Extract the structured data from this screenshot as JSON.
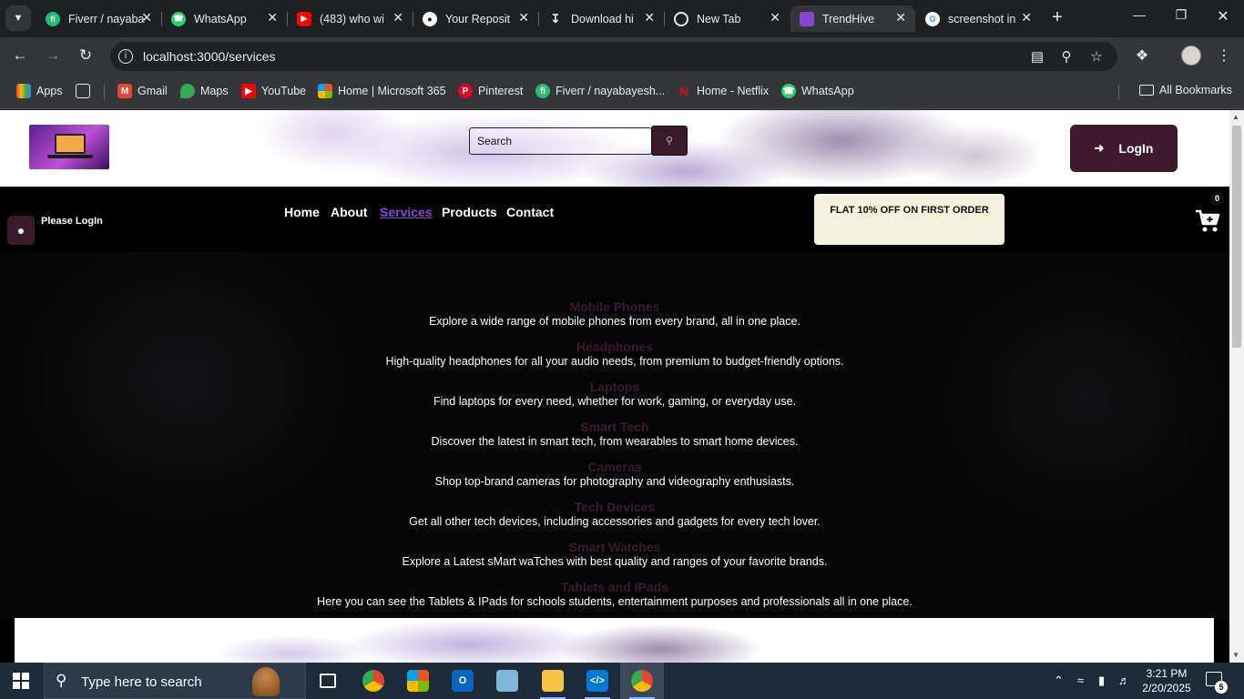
{
  "browser": {
    "tabs": [
      {
        "title": "Fiverr / nayaba",
        "icon": "fiverr-icon",
        "color": "#1dbf73"
      },
      {
        "title": "WhatsApp",
        "icon": "whatsapp-icon",
        "color": "#25d366"
      },
      {
        "title": "(483) who wi",
        "icon": "youtube-icon",
        "color": "#ff0000"
      },
      {
        "title": "Your Reposit",
        "icon": "github-icon",
        "color": "#ffffff"
      },
      {
        "title": "Download hi",
        "icon": "download-icon",
        "color": "#e8eaed"
      },
      {
        "title": "New Tab",
        "icon": "chrome-icon",
        "color": "#e8eaed"
      },
      {
        "title": "TrendHive",
        "icon": "trendhive-icon",
        "color": "#8b45d4",
        "active": true
      },
      {
        "title": "screenshot in",
        "icon": "google-icon",
        "color": "#4285f4"
      }
    ],
    "url": "localhost:3000/services",
    "bookmarks": [
      {
        "label": "Apps",
        "icon": "apps-grid-icon"
      },
      {
        "label": "",
        "icon": "tab-groups-icon"
      },
      {
        "label": "Gmail",
        "icon": "gmail-icon"
      },
      {
        "label": "Maps",
        "icon": "maps-icon"
      },
      {
        "label": "YouTube",
        "icon": "youtube-icon"
      },
      {
        "label": "Home | Microsoft 365",
        "icon": "microsoft-icon"
      },
      {
        "label": "Pinterest",
        "icon": "pinterest-icon"
      },
      {
        "label": "Fiverr / nayabayesh...",
        "icon": "fiverr-icon"
      },
      {
        "label": "Home - Netflix",
        "icon": "netflix-icon"
      },
      {
        "label": "WhatsApp",
        "icon": "whatsapp-icon"
      }
    ],
    "all_bookmarks": "All Bookmarks"
  },
  "site": {
    "search_placeholder": "Search",
    "login_label": "LogIn",
    "please_login": "Please LogIn",
    "nav": [
      {
        "label": "Home",
        "active": false
      },
      {
        "label": "About",
        "active": false
      },
      {
        "label": "Services",
        "active": true
      },
      {
        "label": "Products",
        "active": false
      },
      {
        "label": "Contact",
        "active": false
      }
    ],
    "promo": "FLAT 10% OFF ON FIRST ORDER",
    "cart_count": "0",
    "services": [
      {
        "title": "Mobile Phones",
        "desc": "Explore a wide range of mobile phones from every brand, all in one place."
      },
      {
        "title": "Headphones",
        "desc": "High-quality headphones for all your audio needs, from premium to budget-friendly options."
      },
      {
        "title": "Laptops",
        "desc": "Find laptops for every need, whether for work, gaming, or everyday use."
      },
      {
        "title": "Smart Tech",
        "desc": "Discover the latest in smart tech, from wearables to smart home devices."
      },
      {
        "title": "Cameras",
        "desc": "Shop top-brand cameras for photography and videography enthusiasts."
      },
      {
        "title": "Tech Devices",
        "desc": "Get all other tech devices, including accessories and gadgets for every tech lover."
      },
      {
        "title": "Smart Watches",
        "desc": "Explore a Latest sMart waTches with best quality and ranges of your favorite brands."
      },
      {
        "title": "Tablets and IPads",
        "desc": "Here you can see the Tablets & IPads for schools students, entertainment purposes and professionals all in one place."
      }
    ]
  },
  "taskbar": {
    "search_text": "Type here to search",
    "time": "3:21 PM",
    "date": "2/20/2025",
    "notification_count": "5"
  }
}
